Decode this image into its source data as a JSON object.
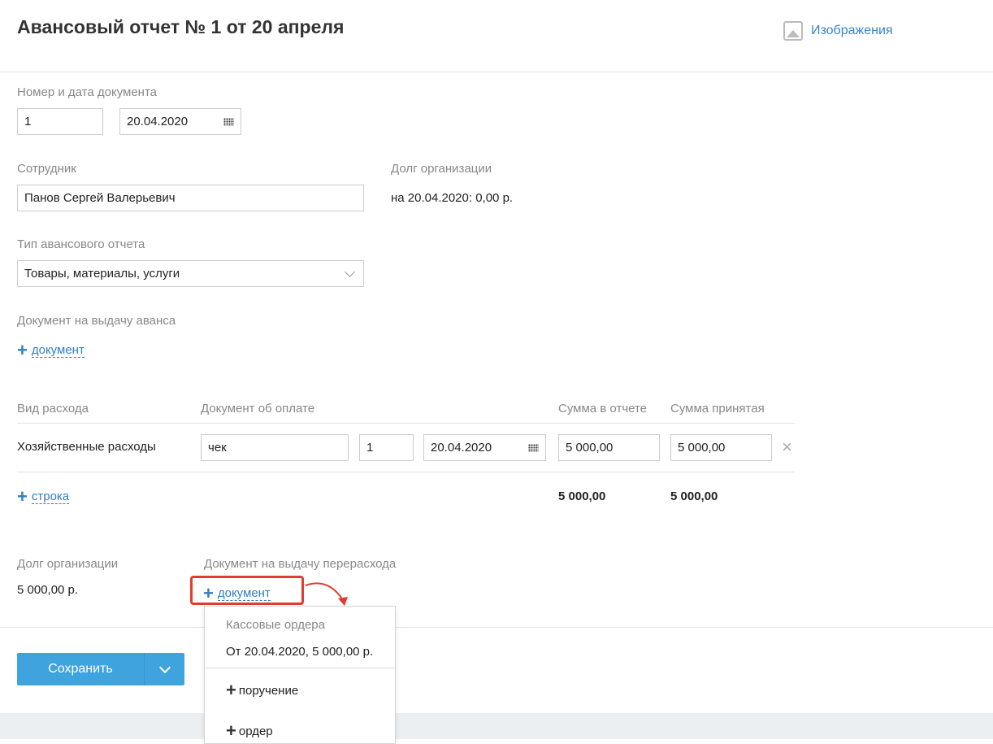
{
  "header": {
    "title": "Авансовый отчет № 1 от 20 апреля",
    "images_link": "Изображения"
  },
  "doc": {
    "label": "Номер и дата документа",
    "number": "1",
    "date": "20.04.2020"
  },
  "employee": {
    "label": "Сотрудник",
    "value": "Панов Сергей Валерьевич"
  },
  "org_debt": {
    "label": "Долг организации",
    "value": "на 20.04.2020: 0,00 р."
  },
  "report_type": {
    "label": "Тип авансового отчета",
    "value": "Товары, материалы, услуги"
  },
  "advance_doc": {
    "label": "Документ на выдачу аванса",
    "add": "документ"
  },
  "table": {
    "headers": [
      "Вид расхода",
      "Документ об оплате",
      "Сумма в отчете",
      "Сумма принятая"
    ],
    "rows": [
      {
        "type": "Хозяйственные расходы",
        "doc": "чек",
        "num": "1",
        "date": "20.04.2020",
        "sum": "5 000,00",
        "accepted": "5 000,00"
      }
    ],
    "add_row": "строка",
    "total_sum": "5 000,00",
    "total_accepted": "5 000,00"
  },
  "overspend": {
    "debt_label": "Долг организации",
    "debt_value": "5 000,00 р.",
    "doc_label": "Документ на выдачу перерасхода",
    "add": "документ"
  },
  "dropdown": {
    "section": "Кассовые ордера",
    "item": "От 20.04.2020, 5 000,00 р.",
    "add_order_payment": "поручение",
    "add_order": "ордер"
  },
  "footer": {
    "save": "Сохранить"
  },
  "colors": {
    "accent": "#3fa3de",
    "link": "#2f7fc6",
    "highlight": "#e23c2f"
  }
}
